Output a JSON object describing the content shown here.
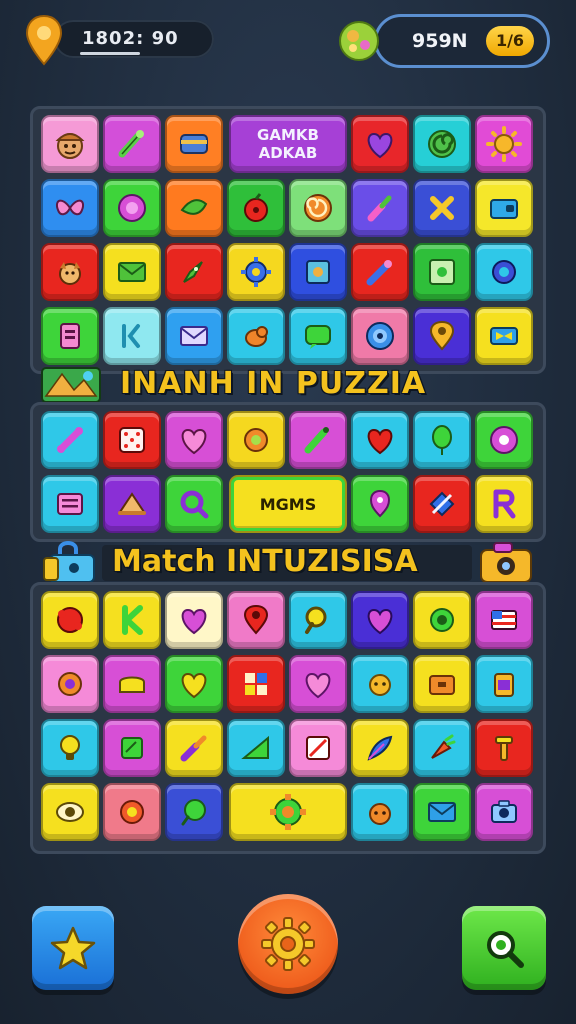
{
  "hud": {
    "location_value": "1802: 90",
    "score_value": "959N",
    "level_badge": "1/6"
  },
  "banners": {
    "upper": "INANH IN PUZZIA",
    "lower": "Match INTUZISISA"
  },
  "special_tiles": {
    "title_tile_line1": "GAMKB",
    "title_tile_line2": "ADKAB",
    "mgms_tile": "MGMS"
  },
  "colors": {
    "background": "#1f2c3d",
    "banner_text": "#f4c21e",
    "accent_blue": "#5b8fd0"
  },
  "bottom_bar": {
    "left": "star-icon",
    "center": "gear-icon",
    "right": "search-icon"
  }
}
